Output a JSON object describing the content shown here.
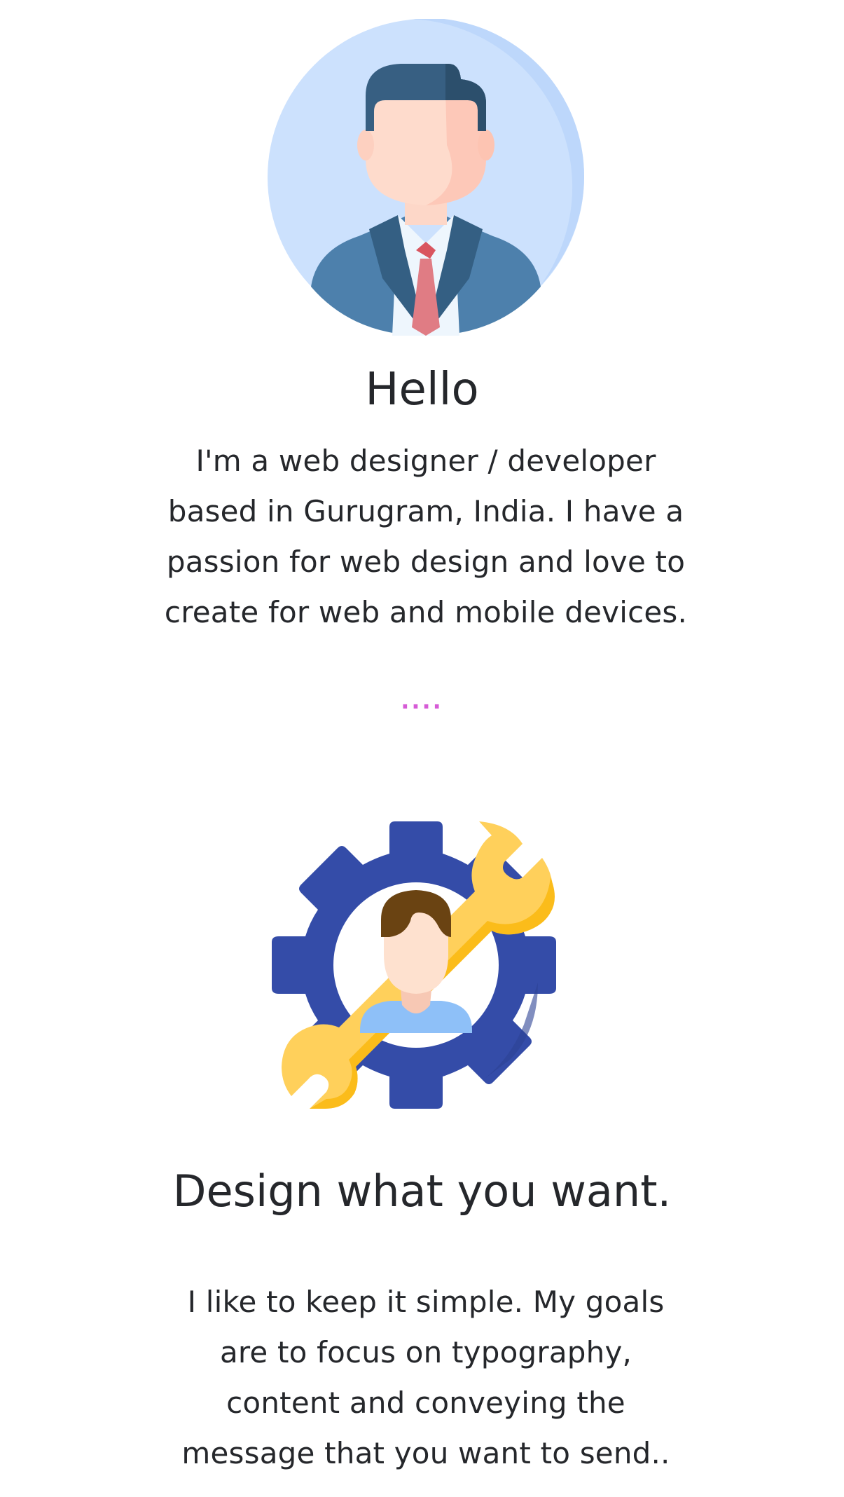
{
  "intro": {
    "avatar_icon": "businessman-avatar-icon",
    "title": "Hello",
    "bio": "I'm a web designer / developer based in Gurugram, India. I have a passion for web design and love to create for web and mobile devices."
  },
  "divider": {
    "text": "....",
    "color": "#d65bd6"
  },
  "design": {
    "illustration_icon": "gear-wrench-person-icon",
    "title": "Design what you want.",
    "text": "I like to keep it simple. My goals are to focus on typography, content and conveying the message that you want to send.."
  },
  "colors": {
    "avatar_bg": "#cce1fd",
    "gear": "#344ca8",
    "wrench": "#ffd05b",
    "text": "#25272b"
  }
}
